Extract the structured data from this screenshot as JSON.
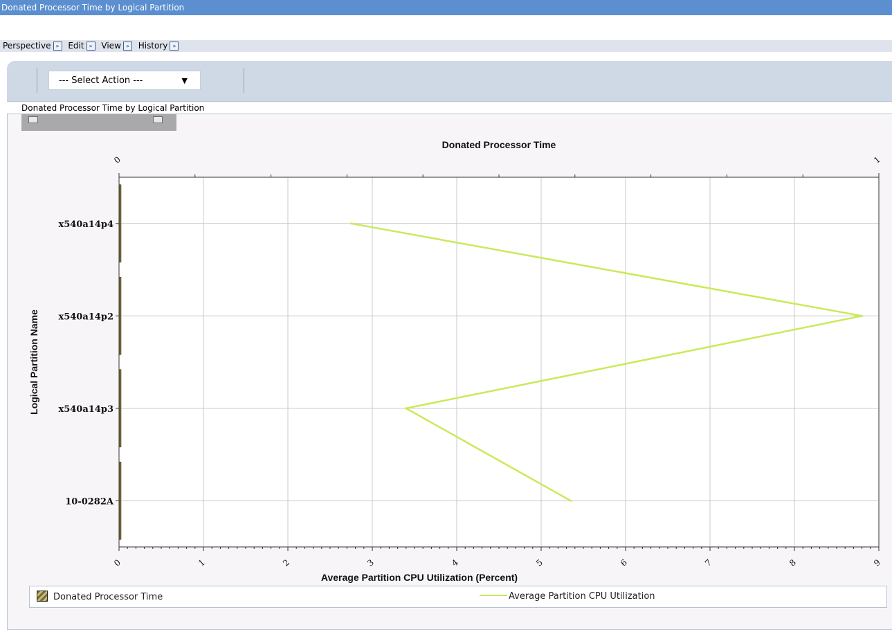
{
  "window": {
    "title": "Donated Processor Time by Logical Partition"
  },
  "menubar": {
    "items": [
      "Perspective",
      "Edit",
      "View",
      "History"
    ]
  },
  "toolbar": {
    "select_action": "--- Select Action ---"
  },
  "section": {
    "title": "Donated Processor Time by Logical Partition"
  },
  "colors": {
    "line": "#c9ea58",
    "bar": "#7a6d31",
    "title_bar": "#5b8fd0"
  },
  "chart_data": {
    "type": "bar",
    "orientation": "horizontal",
    "title": "Donated Processor Time",
    "categories": [
      "x540a14p4",
      "x540a14p2",
      "x540a14p3",
      "10-0282A"
    ],
    "ylabel": "Logical Partition Name",
    "series": [
      {
        "name": "Donated Processor Time",
        "type": "bar",
        "axis": "top",
        "values": [
          0,
          0,
          0,
          0
        ]
      },
      {
        "name": "Average Partition CPU Utilization",
        "type": "line",
        "axis": "bottom",
        "values": [
          2.75,
          8.8,
          3.4,
          5.35
        ]
      }
    ],
    "top_axis": {
      "ticks": [
        "0",
        "1"
      ],
      "range": [
        0,
        1
      ]
    },
    "bottom_axis": {
      "label": "Average Partition CPU Utilization (Percent)",
      "ticks": [
        "0",
        "1",
        "2",
        "3",
        "4",
        "5",
        "6",
        "7",
        "8",
        "9"
      ],
      "range": [
        0,
        9
      ]
    },
    "grid": true,
    "legend_position": "bottom"
  }
}
